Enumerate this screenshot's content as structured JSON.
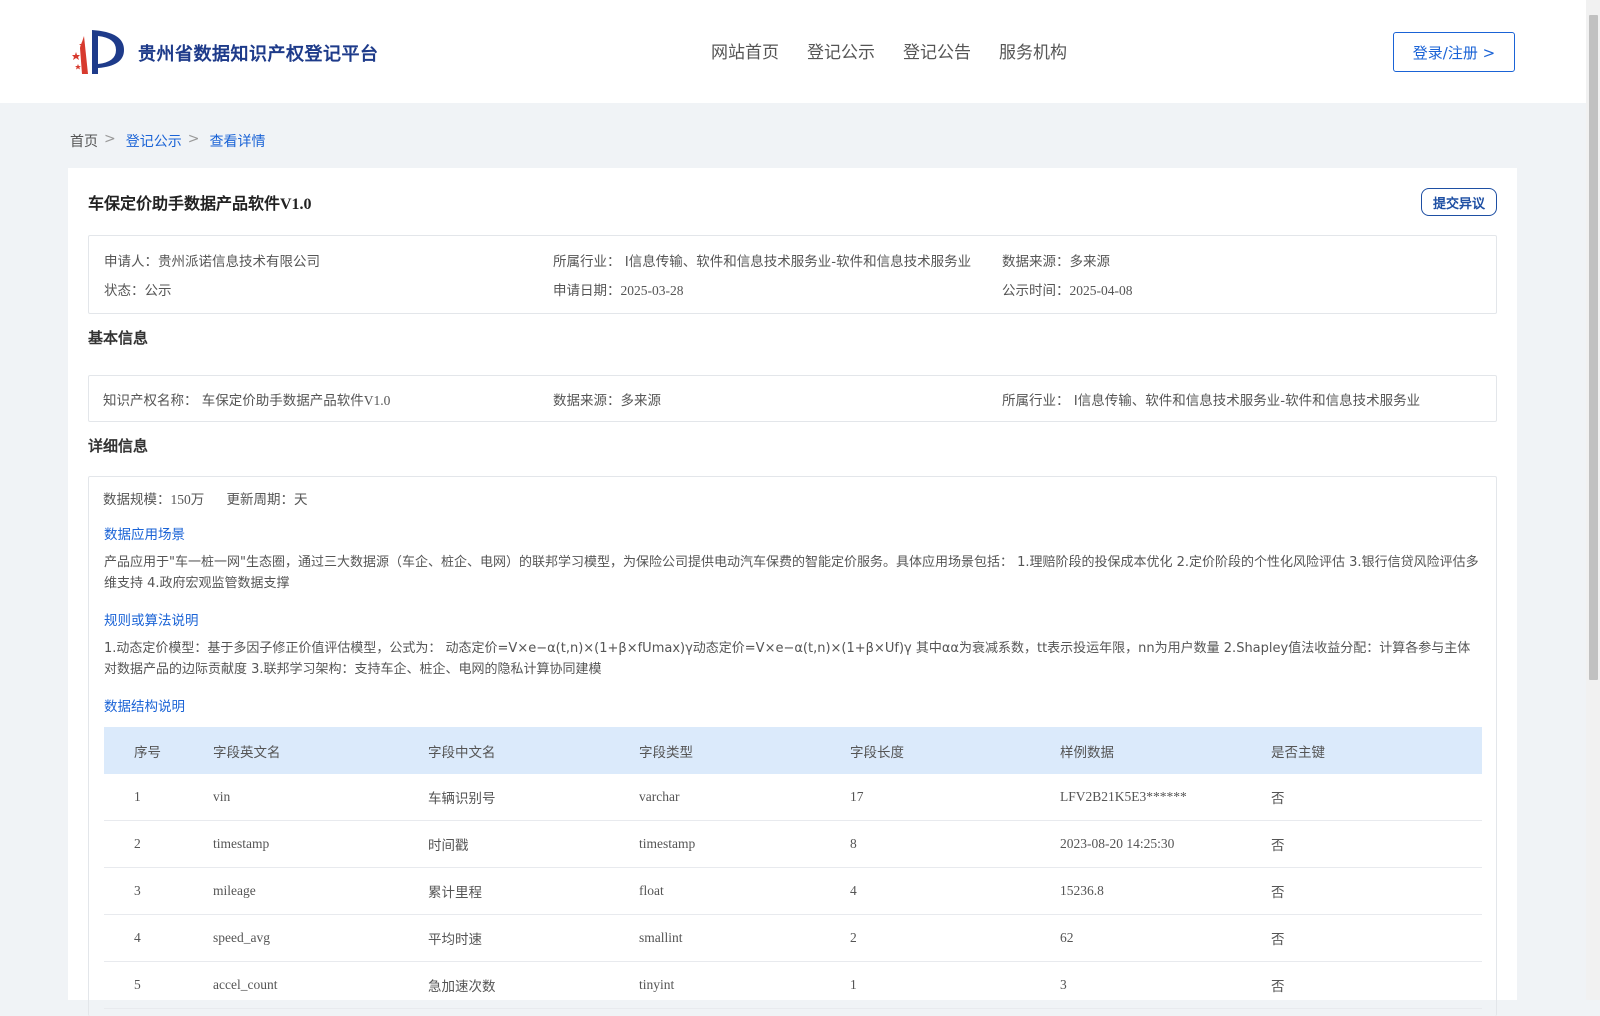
{
  "header": {
    "site_name": "贵州省数据知识产权登记平台",
    "nav": [
      "网站首页",
      "登记公示",
      "登记公告",
      "服务机构"
    ],
    "login_label": "登录/注册 >"
  },
  "breadcrumb": {
    "home": "首页",
    "items": [
      "登记公示",
      "查看详情"
    ],
    "sep": ">"
  },
  "detail": {
    "title": "车保定价助手数据产品软件V1.0",
    "objection_label": "提交异议",
    "summary": {
      "applicant_label": "申请人：",
      "applicant": "贵州派诺信息技术有限公司",
      "industry_label": "所属行业：",
      "industry": "I信息传输、软件和信息技术服务业-软件和信息技术服务业",
      "source_label": "数据来源：",
      "source": "多来源",
      "status_label": "状态：",
      "status": "公示",
      "apply_date_label": "申请日期：",
      "apply_date": "2025-03-28",
      "publish_label": "公示时间：",
      "publish_date": "2025-04-08"
    },
    "basic": {
      "section_title": "基本信息",
      "ip_name_label": "知识产权名称：",
      "ip_name": "车保定价助手数据产品软件V1.0",
      "source_label": "数据来源：",
      "source": "多来源",
      "industry_label": "所属行业：",
      "industry": "I信息传输、软件和信息技术服务业-软件和信息技术服务业"
    },
    "info": {
      "section_title": "详细信息",
      "scale_label": "数据规模：",
      "scale": "150万",
      "cycle_label": "更新周期：",
      "cycle": "天",
      "scene_title": "数据应用场景",
      "scene_text": "产品应用于\"车一桩一网\"生态圈，通过三大数据源（车企、桩企、电网）的联邦学习模型，为保险公司提供电动汽车保费的智能定价服务。具体应用场景包括： 1.理赔阶段的投保成本优化 2.定价阶段的个性化风险评估 3.银行信贷风险评估多维支持 4.政府宏观监管数据支撑",
      "rule_title": "规则或算法说明",
      "rule_text": "1.动态定价模型：基于多因子修正价值评估模型，公式为： 动态定价=V×e−α(t,n)×(1+β×fUmax)γ动态定价=V×e−α(t,n)×(1+β×Uf)γ 其中αα为衰减系数，tt表示投运年限，nn为用户数量 2.Shapley值法收益分配：计算各参与主体对数据产品的边际贡献度 3.联邦学习架构：支持车企、桩企、电网的隐私计算协同建模",
      "struct_title": "数据结构说明"
    },
    "table": {
      "headers": [
        "序号",
        "字段英文名",
        "字段中文名",
        "字段类型",
        "字段长度",
        "样例数据",
        "是否主键"
      ],
      "rows": [
        [
          "1",
          "vin",
          "车辆识别号",
          "varchar",
          "17",
          "LFV2B21K5E3******",
          "否"
        ],
        [
          "2",
          "timestamp",
          "时间戳",
          "timestamp",
          "8",
          "2023-08-20 14:25:30",
          "否"
        ],
        [
          "3",
          "mileage",
          "累计里程",
          "float",
          "4",
          "15236.8",
          "否"
        ],
        [
          "4",
          "speed_avg",
          "平均时速",
          "smallint",
          "2",
          "62",
          "否"
        ],
        [
          "5",
          "accel_count",
          "急加速次数",
          "tinyint",
          "1",
          "3",
          "否"
        ]
      ]
    }
  },
  "colors": {
    "brand": "#1e3b8a",
    "link": "#1a63d6",
    "table_header_bg": "#dbeafb",
    "page_bg": "#f0f3f6"
  }
}
